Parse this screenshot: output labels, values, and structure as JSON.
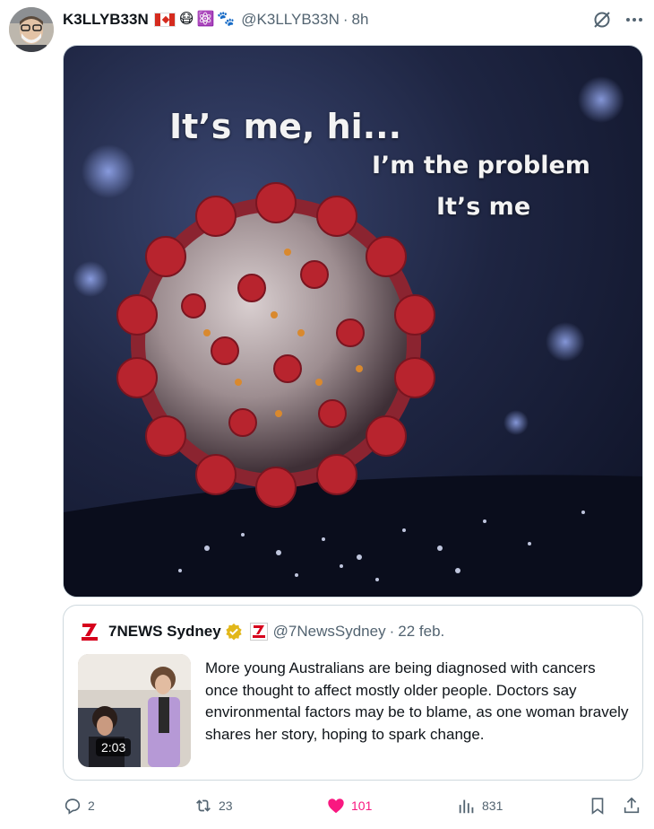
{
  "tweet": {
    "author_name": "K3LLYB33N",
    "author_emojis": [
      "canada-flag",
      "mask-face",
      "atom",
      "paw-prints"
    ],
    "mask_emoji": "😷",
    "atom_emoji": "⚛️",
    "paws_emoji": "🐾",
    "handle": "@K3LLYB33N",
    "separator": "·",
    "time": "8h",
    "image_text": {
      "line1": "It’s me, hi...",
      "line2": "I’m the problem",
      "line3": "It’s me"
    }
  },
  "quote": {
    "author_name": "7NEWS Sydney",
    "handle": "@7NewsSydney",
    "separator": "·",
    "date": "22 feb.",
    "video_duration": "2:03",
    "text": "More young Australians are being diagnosed with cancers once thought to affect mostly older people. Doctors say environmental factors may be to blame, as one woman bravely shares her story, hoping to spark change."
  },
  "actions": {
    "replies": "2",
    "reposts": "23",
    "likes": "101",
    "views": "831"
  },
  "colors": {
    "text": "#0f1419",
    "secondary": "#536471",
    "like": "#f91880",
    "verified_gold": "#e2b719",
    "news_red": "#d6001c",
    "virus_red": "#b8242e"
  }
}
